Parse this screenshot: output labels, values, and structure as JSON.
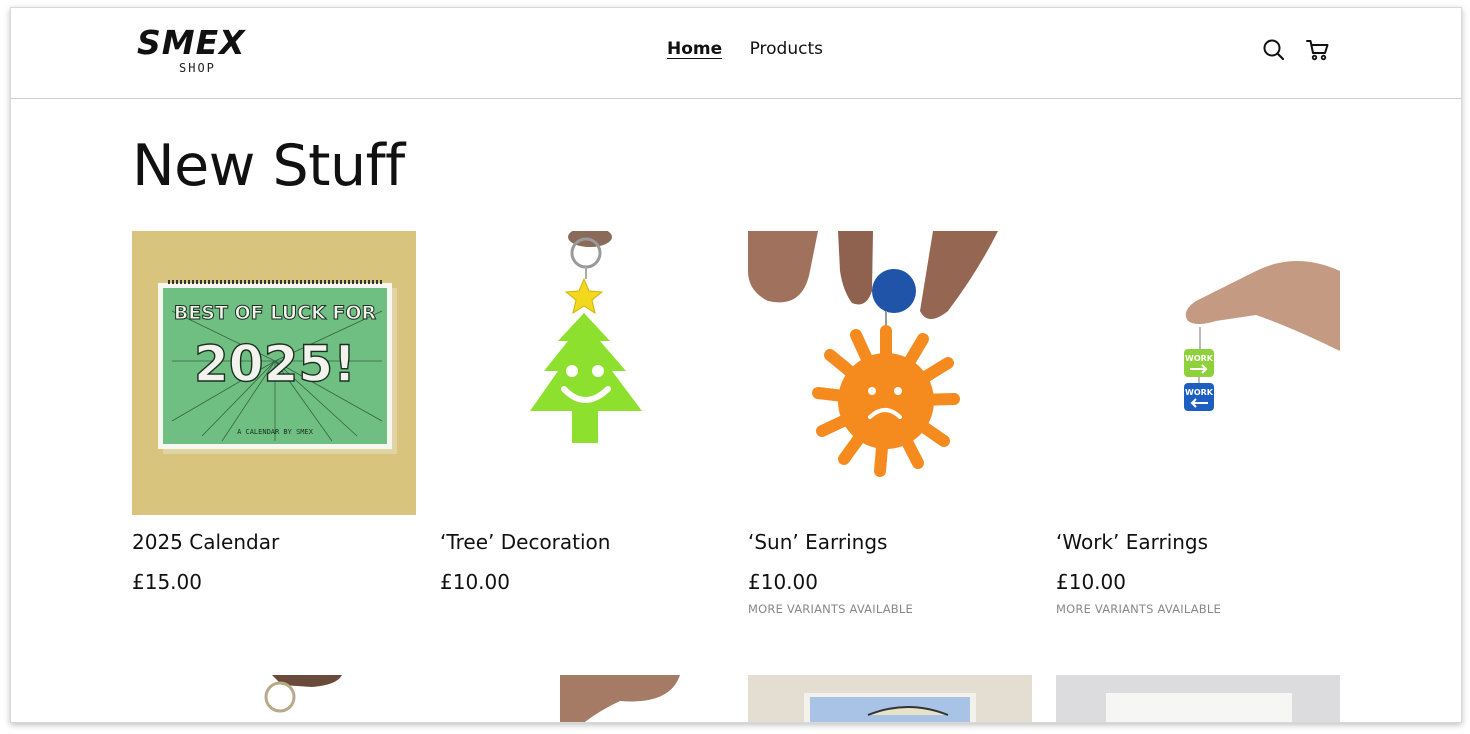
{
  "brand": {
    "name": "SMEX",
    "sub": "SHOP"
  },
  "nav": {
    "items": [
      {
        "label": "Home",
        "active": true
      },
      {
        "label": "Products",
        "active": false
      }
    ]
  },
  "icons": {
    "search": "search-icon",
    "cart": "cart-icon"
  },
  "page": {
    "title": "New Stuff"
  },
  "products": [
    {
      "title": "2025 Calendar",
      "price": "£15.00",
      "note": ""
    },
    {
      "title": "‘Tree’ Decoration",
      "price": "£10.00",
      "note": ""
    },
    {
      "title": "‘Sun’ Earrings",
      "price": "£10.00",
      "note": "MORE VARIANTS AVAILABLE"
    },
    {
      "title": "‘Work’ Earrings",
      "price": "£10.00",
      "note": "MORE VARIANTS AVAILABLE"
    }
  ],
  "calendar_art": {
    "line1": "BEST OF LUCK FOR",
    "line2": "2025!",
    "line3": "A CALENDAR BY SMEX"
  },
  "work_art": {
    "top": "WORK",
    "bottom": "WORK"
  },
  "colors": {
    "calendar_bg": "#d9c47c",
    "calendar_green": "#6fbf82",
    "tree_green": "#8ee02f",
    "sun_orange": "#f58a1f",
    "work_green": "#8fd13a",
    "work_blue": "#1d5fc0",
    "bead_blue": "#1f54a8"
  }
}
